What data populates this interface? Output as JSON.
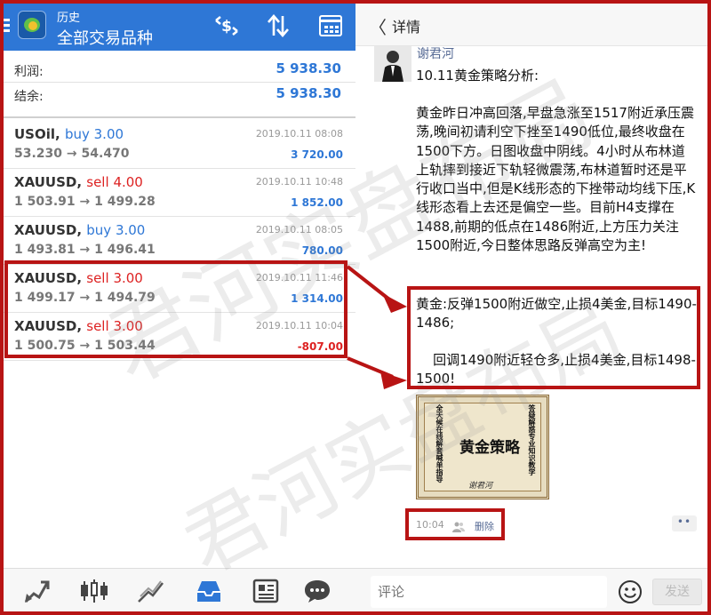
{
  "left": {
    "header": {
      "subtitle": "历史",
      "title": "全部交易品种"
    },
    "summary": [
      {
        "label": "利润:",
        "value": "5 938.30"
      },
      {
        "label": "结余:",
        "value": "5 938.30"
      }
    ],
    "trades": [
      {
        "symbol": "USOil,",
        "side": "buy",
        "lots": "3.00",
        "open": "53.230",
        "close": "54.470",
        "time": "2019.10.11 08:08",
        "profit": "3 720.00",
        "negative": false
      },
      {
        "symbol": "XAUUSD,",
        "side": "sell",
        "lots": "4.00",
        "open": "1 503.91",
        "close": "1 499.28",
        "time": "2019.10.11 10:48",
        "profit": "1 852.00",
        "negative": false
      },
      {
        "symbol": "XAUUSD,",
        "side": "buy",
        "lots": "3.00",
        "open": "1 493.81",
        "close": "1 496.41",
        "time": "2019.10.11 08:05",
        "profit": "780.00",
        "negative": false
      },
      {
        "symbol": "XAUUSD,",
        "side": "sell",
        "lots": "3.00",
        "open": "1 499.17",
        "close": "1 494.79",
        "time": "2019.10.11 11:46",
        "profit": "1 314.00",
        "negative": false
      },
      {
        "symbol": "XAUUSD,",
        "side": "sell",
        "lots": "3.00",
        "open": "1 500.75",
        "close": "1 503.44",
        "time": "2019.10.11 10:04",
        "profit": "-807.00",
        "negative": true
      }
    ],
    "arrow": "→"
  },
  "right": {
    "header": {
      "back": "〈",
      "title": "详情"
    },
    "author": "谢君河",
    "post_title": "10.11黄金策略分析:",
    "paragraph": "黄金昨日冲高回落,早盘急涨至1517附近承压震荡,晚间初请利空下挫至1490低位,最终收盘在1500下方。日图收盘中阴线。4小时从布林道上轨摔到接近下轨轻微震荡,布林道暂时还是平行收口当中,但是K线形态的下挫带动均线下压,K线形态看上去还是偏空一些。目前H4支撑在1488,前期的低点在1486附近,上方压力关注1500附近,今日整体思路反弹高空为主!",
    "strategy1": "黄金:反弹1500附近做空,止损4美金,目标1490-1486;",
    "strategy2": "    回调1490附近轻仓多,止损4美金,目标1498-1500!",
    "card": {
      "title": "黄金策略",
      "left_vertical": "全天候在线解套喊单指导",
      "right_vertical": "答疑解惑专业知识教学",
      "signature": "谢君河"
    },
    "meta_time": "10:04",
    "delete_label": "删除",
    "more_label": "••",
    "comment_placeholder": "评论",
    "send_label": "发送"
  },
  "watermark": "君河实盘布局",
  "colors": {
    "mt4_blue": "#2e77d6",
    "sell_red": "#dd2222",
    "annotation_red": "#b81414",
    "wechat_link": "#576b95"
  }
}
